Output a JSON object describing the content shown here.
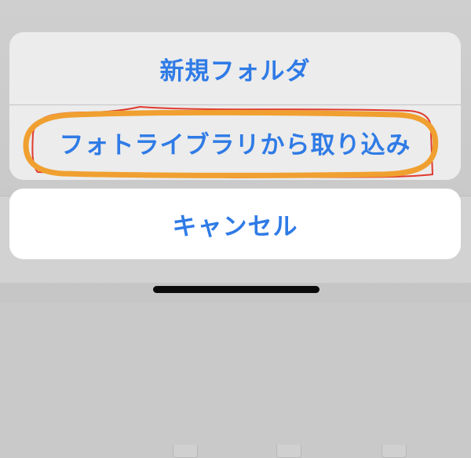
{
  "action_sheet": {
    "options": [
      {
        "label": "新規フォルダ"
      },
      {
        "label": "フォトライブラリから取り込み"
      }
    ],
    "cancel_label": "キャンセル"
  },
  "colors": {
    "action_text": "#2f7be6",
    "sheet_background": "#ececec",
    "cancel_background": "#ffffff",
    "annotation_orange": "#f0a030",
    "annotation_red": "#e03a2f"
  }
}
